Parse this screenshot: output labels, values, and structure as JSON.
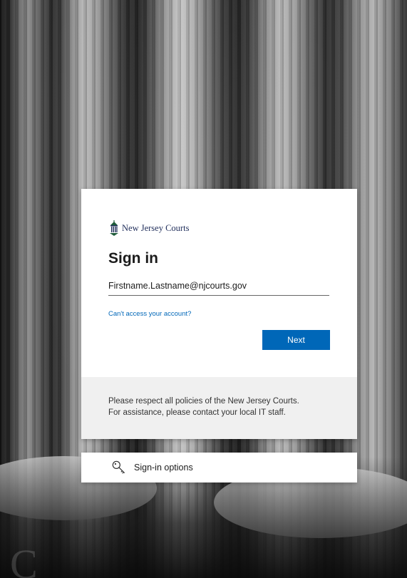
{
  "background": {
    "watermark_text": "C"
  },
  "signin_card": {
    "logo": {
      "icon": "new-jersey-courts-seal-icon",
      "text": "New Jersey Courts"
    },
    "title": "Sign in",
    "email_input": {
      "value": "Firstname.Lastname@njcourts.gov",
      "placeholder": ""
    },
    "cant_access_link": "Can't access your account?",
    "next_button": "Next",
    "notice": {
      "line1": "Please respect all policies of the New Jersey Courts.",
      "line2": "For assistance, please contact your local IT staff."
    }
  },
  "signin_options": {
    "icon": "key-icon",
    "label": "Sign-in options"
  },
  "colors": {
    "accent": "#0067b8",
    "notice_bg": "#f0f0f0",
    "card_bg": "#ffffff"
  }
}
